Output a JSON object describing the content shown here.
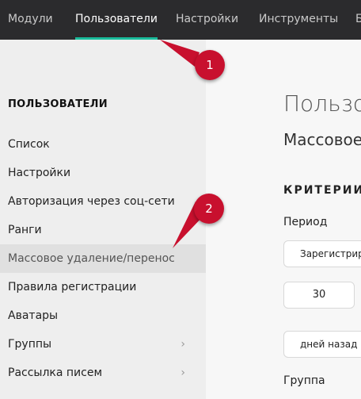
{
  "topnav": {
    "tabs": [
      {
        "label": "Модули"
      },
      {
        "label": "Пользователи"
      },
      {
        "label": "Настройки"
      },
      {
        "label": "Инструменты"
      },
      {
        "label": "Б"
      }
    ],
    "active_index": 1,
    "accent_color": "#1abc9c"
  },
  "sidebar": {
    "heading": "ПОЛЬЗОВАТЕЛИ",
    "items": [
      {
        "label": "Список"
      },
      {
        "label": "Настройки"
      },
      {
        "label": "Авторизация через соц-сети"
      },
      {
        "label": "Ранги"
      },
      {
        "label": "Массовое удаление/перенос"
      },
      {
        "label": "Правила регистрации"
      },
      {
        "label": "Аватары"
      },
      {
        "label": "Группы",
        "chevron": "›"
      },
      {
        "label": "Рассылка писем",
        "chevron": "›"
      }
    ],
    "selected_index": 4
  },
  "main": {
    "title": "Пользо",
    "subtitle": "Массовое",
    "section": "КРИТЕРИИ",
    "period_label": "Период",
    "period_value": "Зарегистрир",
    "number_value": "30",
    "days_value": "дней назад и",
    "group_label": "Группа"
  },
  "markers": [
    {
      "label": "1"
    },
    {
      "label": "2"
    }
  ],
  "marker_color": "#c8102e"
}
